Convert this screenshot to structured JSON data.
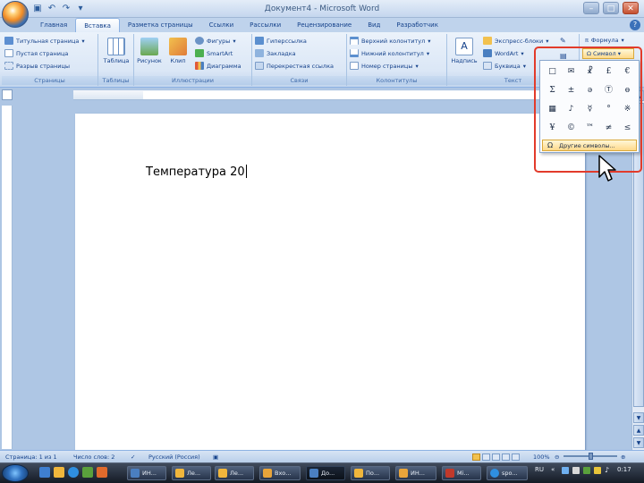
{
  "window": {
    "title": "Документ4 - Microsoft Word"
  },
  "tabs": [
    "Главная",
    "Вставка",
    "Разметка страницы",
    "Ссылки",
    "Рассылки",
    "Рецензирование",
    "Вид",
    "Разработчик"
  ],
  "active_tab": "Вставка",
  "ribbon": {
    "pages": {
      "items": [
        "Титульная страница",
        "Пустая страница",
        "Разрыв страницы"
      ],
      "label": "Страницы"
    },
    "tables": {
      "button": "Таблица",
      "label": "Таблицы"
    },
    "illustrations": {
      "picture": "Рисунок",
      "clip": "Клип",
      "shapes": "Фигуры",
      "smartart": "SmartArt",
      "chart": "Диаграмма",
      "label": "Иллюстрации"
    },
    "links": {
      "items": [
        "Гиперссылка",
        "Закладка",
        "Перекрестная ссылка"
      ],
      "label": "Связи"
    },
    "header_footer": {
      "items": [
        "Верхний колонтитул",
        "Нижний колонтитул",
        "Номер страницы"
      ],
      "label": "Колонтитулы"
    },
    "text": {
      "textbox": "Надпись",
      "quickparts": "Экспресс-блоки",
      "wordart": "WordArt",
      "dropcap": "Буквица",
      "label": "Текст"
    },
    "symbols": {
      "formula": "Формула",
      "symbol": "Символ"
    }
  },
  "document": {
    "text": "Температура 20"
  },
  "symbol_menu": {
    "symbols": [
      "□",
      "✉",
      "☧",
      "£",
      "€",
      "Σ",
      "±",
      "ǝ",
      "Ⓣ",
      "ɵ",
      "▦",
      "♪",
      "☿",
      "°",
      "※",
      "¥",
      "©",
      "™",
      "≠",
      "≤"
    ],
    "more": "Другие символы..."
  },
  "status": {
    "page": "Страница: 1 из 1",
    "words": "Число слов: 2",
    "language": "Русский (Россия)",
    "zoom": "100%"
  },
  "taskbar": {
    "items": [
      "ИН...",
      "Ле...",
      "Ле...",
      "Вхо...",
      "До...",
      "По...",
      "ИН...",
      "Mi...",
      "spo..."
    ],
    "lang": "RU",
    "clock": "0:17"
  }
}
